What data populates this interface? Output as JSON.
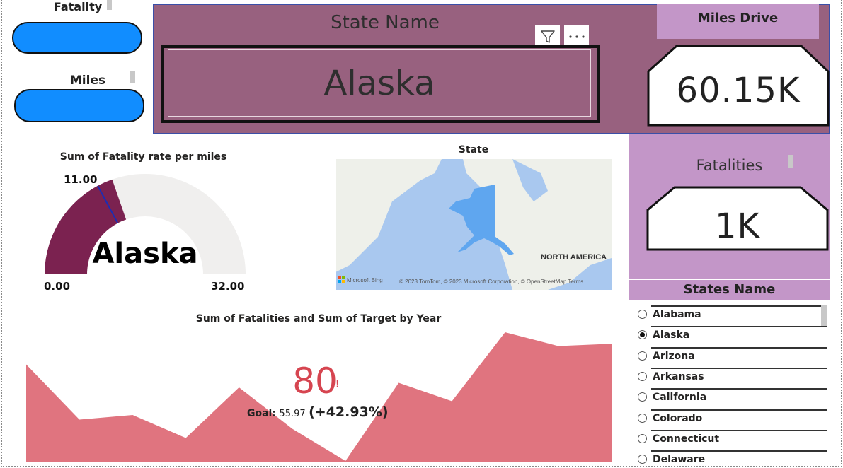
{
  "slicers": {
    "fatality_title": "Fatality",
    "miles_title": "Miles"
  },
  "state_banner": {
    "title": "State Name",
    "value": "Alaska"
  },
  "miles_card": {
    "title": "Miles Drive",
    "value": "60.15K"
  },
  "fatalities_card": {
    "title": "Fatalities",
    "value": "1K"
  },
  "gauge": {
    "title": "Sum of Fatality rate per miles",
    "min_label": "0.00",
    "max_label": "32.00",
    "target_label": "11.00",
    "state_label": "Alaska",
    "value": 12.6,
    "min": 0,
    "max": 32,
    "target": 11,
    "fill_color": "#7b2250",
    "track_color": "#f0efee",
    "target_color": "#1a2db5"
  },
  "map": {
    "title": "State",
    "region_label": "NORTH AMERICA",
    "attribution": "© 2023 TomTom, © 2023 Microsoft Corporation, © OpenStreetMap  Terms",
    "bing_label": "Microsoft Bing",
    "highlight_color": "#5fa6ef",
    "water_color": "#a9c8ef",
    "land_color": "#eef0ea"
  },
  "kpi_chart": {
    "title": "Sum of Fatalities and Sum of Target by Year",
    "value": "80",
    "value_flag": "!",
    "goal_prefix": "Goal:",
    "goal_value": "55.97",
    "delta": "(+42.93%)",
    "value_color": "#d64550",
    "area_color": "#e0747f",
    "chart_data": {
      "type": "area",
      "series": [
        {
          "values": [
            83,
            71,
            72,
            67,
            78,
            69,
            62,
            79,
            75,
            90,
            87,
            87.5
          ]
        }
      ],
      "ylim": [
        62,
        90
      ]
    }
  },
  "states_list": {
    "title": "States Name",
    "items": [
      {
        "label": "Alabama",
        "selected": false
      },
      {
        "label": "Alaska",
        "selected": true
      },
      {
        "label": "Arizona",
        "selected": false
      },
      {
        "label": "Arkansas",
        "selected": false
      },
      {
        "label": "California",
        "selected": false
      },
      {
        "label": "Colorado",
        "selected": false
      },
      {
        "label": "Connecticut",
        "selected": false
      },
      {
        "label": "Delaware",
        "selected": false
      }
    ]
  }
}
